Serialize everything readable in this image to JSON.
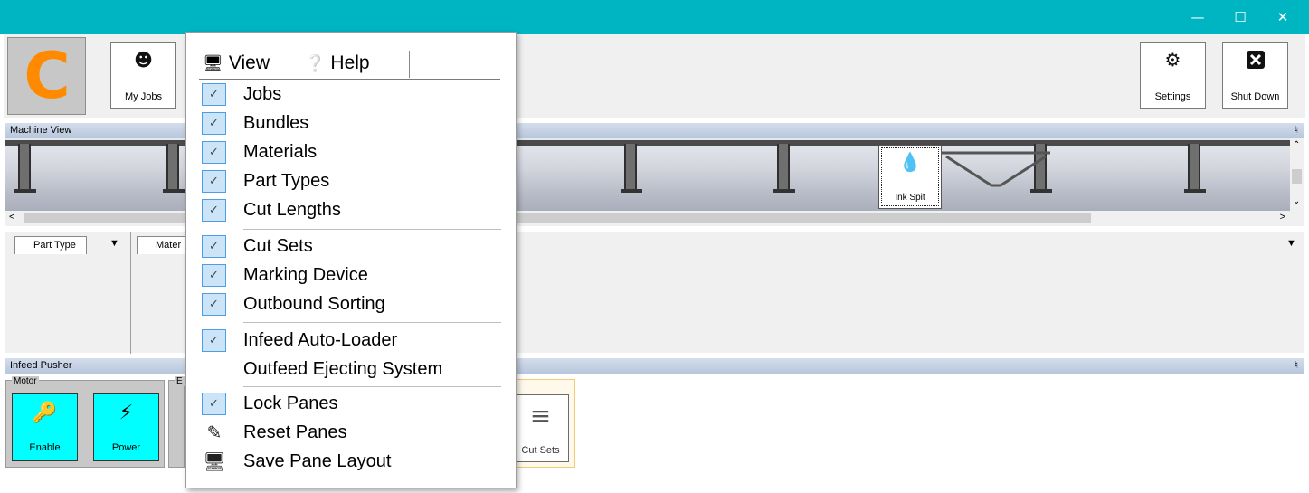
{
  "window": {
    "minimize": "—",
    "maximize": "☐",
    "close": "✕",
    "accent": "#00b5c2"
  },
  "logo": {
    "letter": "C",
    "color": "#ff8a00"
  },
  "ribbon": {
    "my_jobs": {
      "label": "My Jobs",
      "icon": "user-gear-icon"
    },
    "settings": {
      "label": "Settings",
      "icon": "gear-icon"
    },
    "shut_down": {
      "label": "Shut Down",
      "icon": "close-box-icon"
    }
  },
  "machine_view": {
    "title": "Machine View",
    "ink_spit": {
      "label": "Ink Spit",
      "icon": "ink-drop-icon"
    }
  },
  "middle_pane": {
    "tabs": [
      {
        "label": "Part Type"
      },
      {
        "label": "Mater"
      }
    ]
  },
  "infeed_pusher": {
    "title": "Infeed Pusher",
    "motor_group": {
      "label": "Motor"
    },
    "second_group": {
      "label": "E"
    },
    "buttons": [
      {
        "label": "Enable",
        "icon": "key-icon"
      },
      {
        "label": "Power",
        "icon": "lightning-icon"
      }
    ],
    "cut_sets": {
      "label": "Cut Sets",
      "icon": "lines-icon"
    }
  },
  "menu": {
    "tabs": [
      {
        "label": "View",
        "icon": "monitor-icon"
      },
      {
        "label": "Help",
        "icon": "question-icon"
      }
    ],
    "items": [
      {
        "label": "Jobs",
        "checked": true
      },
      {
        "label": "Bundles",
        "checked": true
      },
      {
        "label": "Materials",
        "checked": true
      },
      {
        "label": "Part Types",
        "checked": true
      },
      {
        "label": "Cut Lengths",
        "checked": true
      },
      {
        "label": "Cut Sets",
        "checked": true
      },
      {
        "label": "Marking Device",
        "checked": true
      },
      {
        "label": "Outbound Sorting",
        "checked": true
      },
      {
        "label": "Infeed Auto-Loader",
        "checked": true
      },
      {
        "label": "Outfeed Ejecting System",
        "checked": false
      },
      {
        "label": "Lock Panes",
        "checked": true
      },
      {
        "label": "Reset Panes",
        "icon": "eraser-icon"
      },
      {
        "label": "Save Pane Layout",
        "icon": "monitor-save-icon"
      }
    ]
  }
}
